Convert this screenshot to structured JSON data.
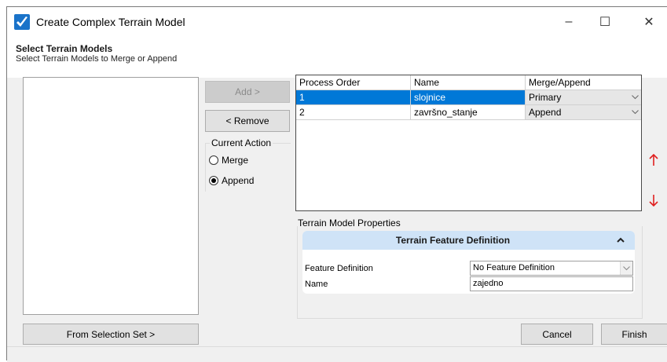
{
  "window": {
    "title": "Create Complex Terrain Model",
    "minimize_glyph": "–",
    "maximize_glyph": "☐",
    "close_glyph": "✕"
  },
  "header": {
    "title": "Select Terrain Models",
    "subtitle": "Select Terrain Models to Merge or Append"
  },
  "buttons": {
    "add": "Add >",
    "remove": "< Remove",
    "from_selection_set": "From Selection Set >",
    "cancel": "Cancel",
    "finish": "Finish"
  },
  "current_action": {
    "label": "Current Action",
    "options": [
      {
        "label": "Merge",
        "checked": false
      },
      {
        "label": "Append",
        "checked": true
      }
    ]
  },
  "grid": {
    "columns": [
      "Process Order",
      "Name",
      "Merge/Append"
    ],
    "rows": [
      {
        "order": "1",
        "name": "slojnice",
        "mode": "Primary",
        "selected": true
      },
      {
        "order": "2",
        "name": "završno_stanje",
        "mode": "Append",
        "selected": false
      }
    ]
  },
  "move_buttons": {
    "up": "↑",
    "down": "↓",
    "color": "#e02020"
  },
  "properties": {
    "group_label": "Terrain Model Properties",
    "panel_title": "Terrain Feature Definition",
    "rows": [
      {
        "name": "Feature Definition",
        "value": "No Feature Definition"
      },
      {
        "name": "Name",
        "value": "zajedno"
      }
    ]
  },
  "colors": {
    "selection": "#0078d7",
    "panel_header": "#cfe3f7"
  }
}
